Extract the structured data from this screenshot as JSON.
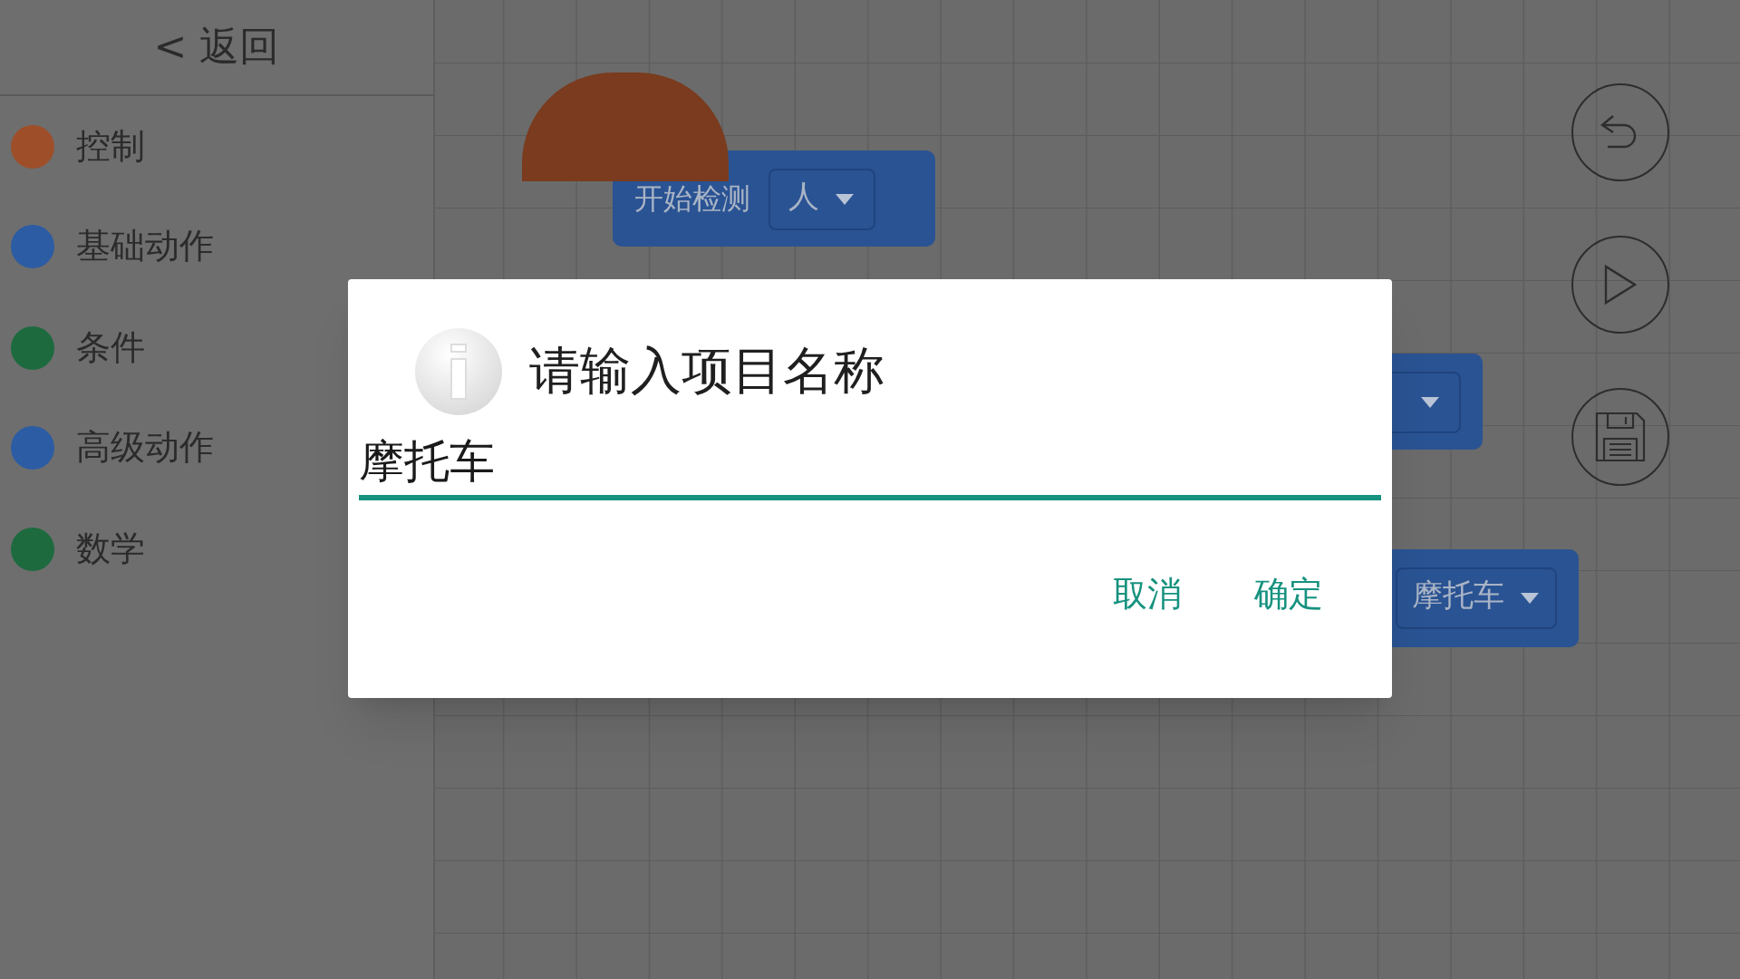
{
  "sidebar": {
    "back": "< 返回",
    "categories": [
      {
        "label": "控制",
        "color": "#9e4f2a"
      },
      {
        "label": "基础动作",
        "color": "#2c5ca3"
      },
      {
        "label": "条件",
        "color": "#1d6a3f"
      },
      {
        "label": "高级动作",
        "color": "#2c5ca3"
      },
      {
        "label": "数学",
        "color": "#1d6a3f"
      }
    ]
  },
  "canvas": {
    "blocks": [
      {
        "kind": "hat",
        "label": "开始检测",
        "dropdown": "人"
      },
      {
        "kind": "covered"
      },
      {
        "kind": "value",
        "dropdown": "摩托车"
      }
    ]
  },
  "dialog": {
    "title": "请输入项目名称",
    "input": {
      "value": "摩托车"
    },
    "buttons": [
      "取消",
      "确定"
    ]
  }
}
